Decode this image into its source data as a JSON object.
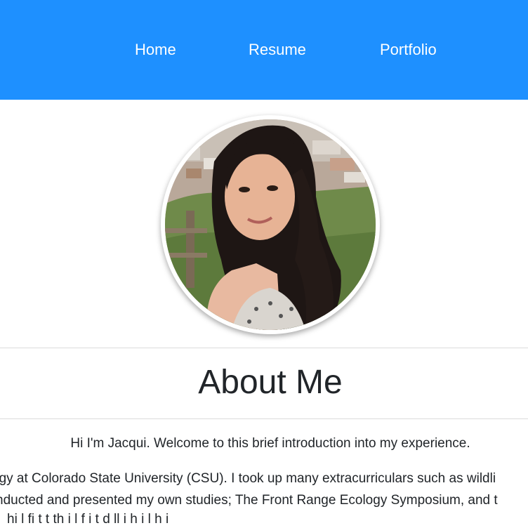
{
  "nav": {
    "items": [
      {
        "label": "Home"
      },
      {
        "label": "Resume"
      },
      {
        "label": "Portfolio"
      }
    ],
    "background_color": "#1e90ff"
  },
  "profile": {
    "image_icon": "profile-photo"
  },
  "about": {
    "heading": "About Me",
    "intro": "Hi I'm Jacqui. Welcome to this brief introduction into my experience.",
    "bio_lines": [
      "ogy at Colorado State University (CSU). I took up many extracurriculars such as wildli",
      "nducted and presented my own studies; The Front Range Ecology Symposium, and t",
      "hi   l        fi t              t  th        i  l   f i  t          d ll        i  h        i       l         h  i"
    ]
  }
}
